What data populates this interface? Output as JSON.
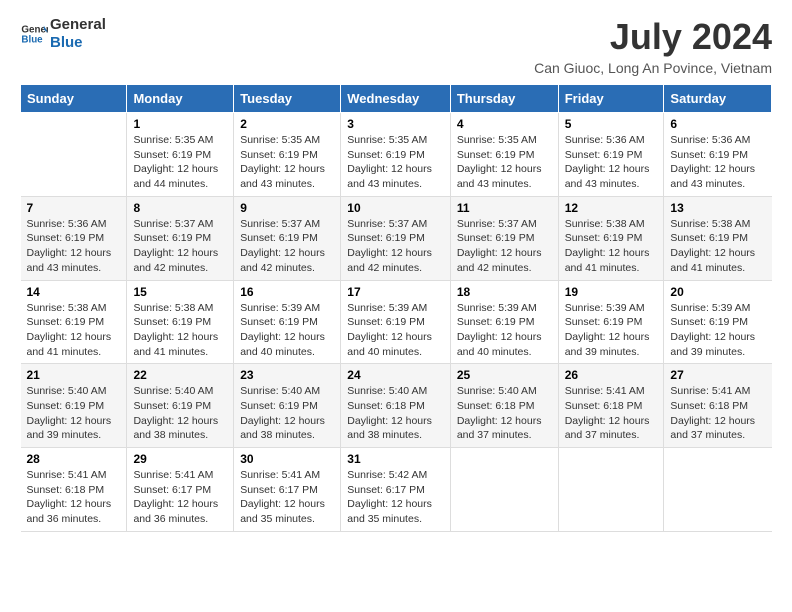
{
  "logo": {
    "line1": "General",
    "line2": "Blue"
  },
  "title": "July 2024",
  "subtitle": "Can Giuoc, Long An Povince, Vietnam",
  "weekdays": [
    "Sunday",
    "Monday",
    "Tuesday",
    "Wednesday",
    "Thursday",
    "Friday",
    "Saturday"
  ],
  "weeks": [
    [
      {
        "day": "",
        "sunrise": "",
        "sunset": "",
        "daylight": ""
      },
      {
        "day": "1",
        "sunrise": "Sunrise: 5:35 AM",
        "sunset": "Sunset: 6:19 PM",
        "daylight": "Daylight: 12 hours and 44 minutes."
      },
      {
        "day": "2",
        "sunrise": "Sunrise: 5:35 AM",
        "sunset": "Sunset: 6:19 PM",
        "daylight": "Daylight: 12 hours and 43 minutes."
      },
      {
        "day": "3",
        "sunrise": "Sunrise: 5:35 AM",
        "sunset": "Sunset: 6:19 PM",
        "daylight": "Daylight: 12 hours and 43 minutes."
      },
      {
        "day": "4",
        "sunrise": "Sunrise: 5:35 AM",
        "sunset": "Sunset: 6:19 PM",
        "daylight": "Daylight: 12 hours and 43 minutes."
      },
      {
        "day": "5",
        "sunrise": "Sunrise: 5:36 AM",
        "sunset": "Sunset: 6:19 PM",
        "daylight": "Daylight: 12 hours and 43 minutes."
      },
      {
        "day": "6",
        "sunrise": "Sunrise: 5:36 AM",
        "sunset": "Sunset: 6:19 PM",
        "daylight": "Daylight: 12 hours and 43 minutes."
      }
    ],
    [
      {
        "day": "7",
        "sunrise": "Sunrise: 5:36 AM",
        "sunset": "Sunset: 6:19 PM",
        "daylight": "Daylight: 12 hours and 43 minutes."
      },
      {
        "day": "8",
        "sunrise": "Sunrise: 5:37 AM",
        "sunset": "Sunset: 6:19 PM",
        "daylight": "Daylight: 12 hours and 42 minutes."
      },
      {
        "day": "9",
        "sunrise": "Sunrise: 5:37 AM",
        "sunset": "Sunset: 6:19 PM",
        "daylight": "Daylight: 12 hours and 42 minutes."
      },
      {
        "day": "10",
        "sunrise": "Sunrise: 5:37 AM",
        "sunset": "Sunset: 6:19 PM",
        "daylight": "Daylight: 12 hours and 42 minutes."
      },
      {
        "day": "11",
        "sunrise": "Sunrise: 5:37 AM",
        "sunset": "Sunset: 6:19 PM",
        "daylight": "Daylight: 12 hours and 42 minutes."
      },
      {
        "day": "12",
        "sunrise": "Sunrise: 5:38 AM",
        "sunset": "Sunset: 6:19 PM",
        "daylight": "Daylight: 12 hours and 41 minutes."
      },
      {
        "day": "13",
        "sunrise": "Sunrise: 5:38 AM",
        "sunset": "Sunset: 6:19 PM",
        "daylight": "Daylight: 12 hours and 41 minutes."
      }
    ],
    [
      {
        "day": "14",
        "sunrise": "Sunrise: 5:38 AM",
        "sunset": "Sunset: 6:19 PM",
        "daylight": "Daylight: 12 hours and 41 minutes."
      },
      {
        "day": "15",
        "sunrise": "Sunrise: 5:38 AM",
        "sunset": "Sunset: 6:19 PM",
        "daylight": "Daylight: 12 hours and 41 minutes."
      },
      {
        "day": "16",
        "sunrise": "Sunrise: 5:39 AM",
        "sunset": "Sunset: 6:19 PM",
        "daylight": "Daylight: 12 hours and 40 minutes."
      },
      {
        "day": "17",
        "sunrise": "Sunrise: 5:39 AM",
        "sunset": "Sunset: 6:19 PM",
        "daylight": "Daylight: 12 hours and 40 minutes."
      },
      {
        "day": "18",
        "sunrise": "Sunrise: 5:39 AM",
        "sunset": "Sunset: 6:19 PM",
        "daylight": "Daylight: 12 hours and 40 minutes."
      },
      {
        "day": "19",
        "sunrise": "Sunrise: 5:39 AM",
        "sunset": "Sunset: 6:19 PM",
        "daylight": "Daylight: 12 hours and 39 minutes."
      },
      {
        "day": "20",
        "sunrise": "Sunrise: 5:39 AM",
        "sunset": "Sunset: 6:19 PM",
        "daylight": "Daylight: 12 hours and 39 minutes."
      }
    ],
    [
      {
        "day": "21",
        "sunrise": "Sunrise: 5:40 AM",
        "sunset": "Sunset: 6:19 PM",
        "daylight": "Daylight: 12 hours and 39 minutes."
      },
      {
        "day": "22",
        "sunrise": "Sunrise: 5:40 AM",
        "sunset": "Sunset: 6:19 PM",
        "daylight": "Daylight: 12 hours and 38 minutes."
      },
      {
        "day": "23",
        "sunrise": "Sunrise: 5:40 AM",
        "sunset": "Sunset: 6:19 PM",
        "daylight": "Daylight: 12 hours and 38 minutes."
      },
      {
        "day": "24",
        "sunrise": "Sunrise: 5:40 AM",
        "sunset": "Sunset: 6:18 PM",
        "daylight": "Daylight: 12 hours and 38 minutes."
      },
      {
        "day": "25",
        "sunrise": "Sunrise: 5:40 AM",
        "sunset": "Sunset: 6:18 PM",
        "daylight": "Daylight: 12 hours and 37 minutes."
      },
      {
        "day": "26",
        "sunrise": "Sunrise: 5:41 AM",
        "sunset": "Sunset: 6:18 PM",
        "daylight": "Daylight: 12 hours and 37 minutes."
      },
      {
        "day": "27",
        "sunrise": "Sunrise: 5:41 AM",
        "sunset": "Sunset: 6:18 PM",
        "daylight": "Daylight: 12 hours and 37 minutes."
      }
    ],
    [
      {
        "day": "28",
        "sunrise": "Sunrise: 5:41 AM",
        "sunset": "Sunset: 6:18 PM",
        "daylight": "Daylight: 12 hours and 36 minutes."
      },
      {
        "day": "29",
        "sunrise": "Sunrise: 5:41 AM",
        "sunset": "Sunset: 6:17 PM",
        "daylight": "Daylight: 12 hours and 36 minutes."
      },
      {
        "day": "30",
        "sunrise": "Sunrise: 5:41 AM",
        "sunset": "Sunset: 6:17 PM",
        "daylight": "Daylight: 12 hours and 35 minutes."
      },
      {
        "day": "31",
        "sunrise": "Sunrise: 5:42 AM",
        "sunset": "Sunset: 6:17 PM",
        "daylight": "Daylight: 12 hours and 35 minutes."
      },
      {
        "day": "",
        "sunrise": "",
        "sunset": "",
        "daylight": ""
      },
      {
        "day": "",
        "sunrise": "",
        "sunset": "",
        "daylight": ""
      },
      {
        "day": "",
        "sunrise": "",
        "sunset": "",
        "daylight": ""
      }
    ]
  ]
}
